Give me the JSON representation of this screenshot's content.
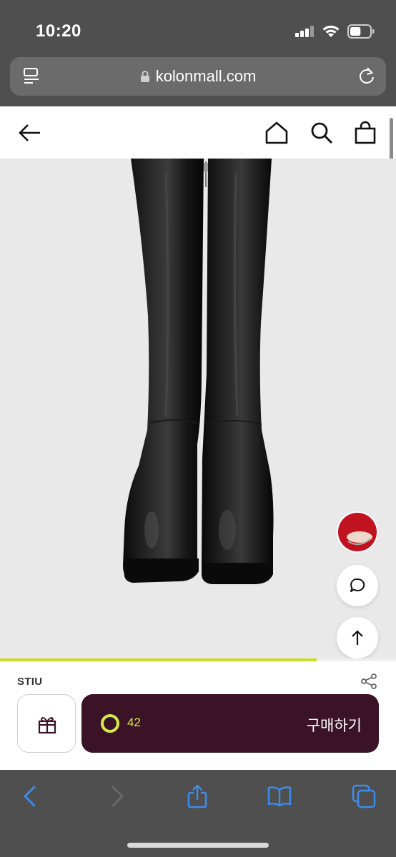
{
  "status_bar": {
    "time": "10:20",
    "battery_level": 0.55
  },
  "browser": {
    "url": "kolonmall.com"
  },
  "product": {
    "brand": "STIU",
    "likes": "42",
    "buy_label": "구매하기",
    "image_progress": 0.8
  },
  "colors": {
    "buy_button": "#3b1326",
    "accent": "#c6df25",
    "like_text": "#d6ea4a"
  },
  "icons": {
    "header": [
      "back-arrow-icon",
      "home-icon",
      "search-icon",
      "shopping-bag-icon"
    ],
    "floating": [
      "chat-icon",
      "scroll-top-icon"
    ],
    "toolbar": [
      "back-icon",
      "forward-icon",
      "share-icon",
      "bookmarks-icon",
      "tabs-icon"
    ]
  }
}
